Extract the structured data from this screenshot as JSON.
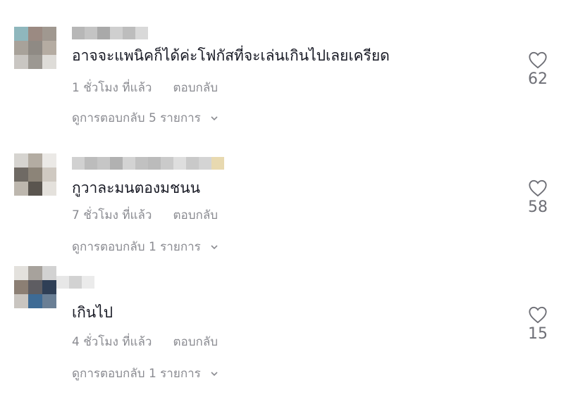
{
  "comments": [
    {
      "text": "อาจจะแพนิคก็ได้ค่ะโฟกัสที่จะเล่นเกินไปเลยเครียด",
      "time": "1 ชั่วโมง ที่แล้ว",
      "reply": "ตอบกลับ",
      "view_replies": "ดูการตอบกลับ 5 รายการ",
      "likes": "62"
    },
    {
      "text": "กูวาละมนตองมชนน",
      "time": "7 ชั่วโมง ที่แล้ว",
      "reply": "ตอบกลับ",
      "view_replies": "ดูการตอบกลับ 1 รายการ",
      "likes": "58"
    },
    {
      "text": "เกินไป",
      "time": "4 ชั่วโมง ที่แล้ว",
      "reply": "ตอบกลับ",
      "view_replies": "ดูการตอบกลับ 1 รายการ",
      "likes": "15"
    }
  ],
  "icons": {
    "like": "heart-icon",
    "expand": "chevron-down-icon"
  }
}
